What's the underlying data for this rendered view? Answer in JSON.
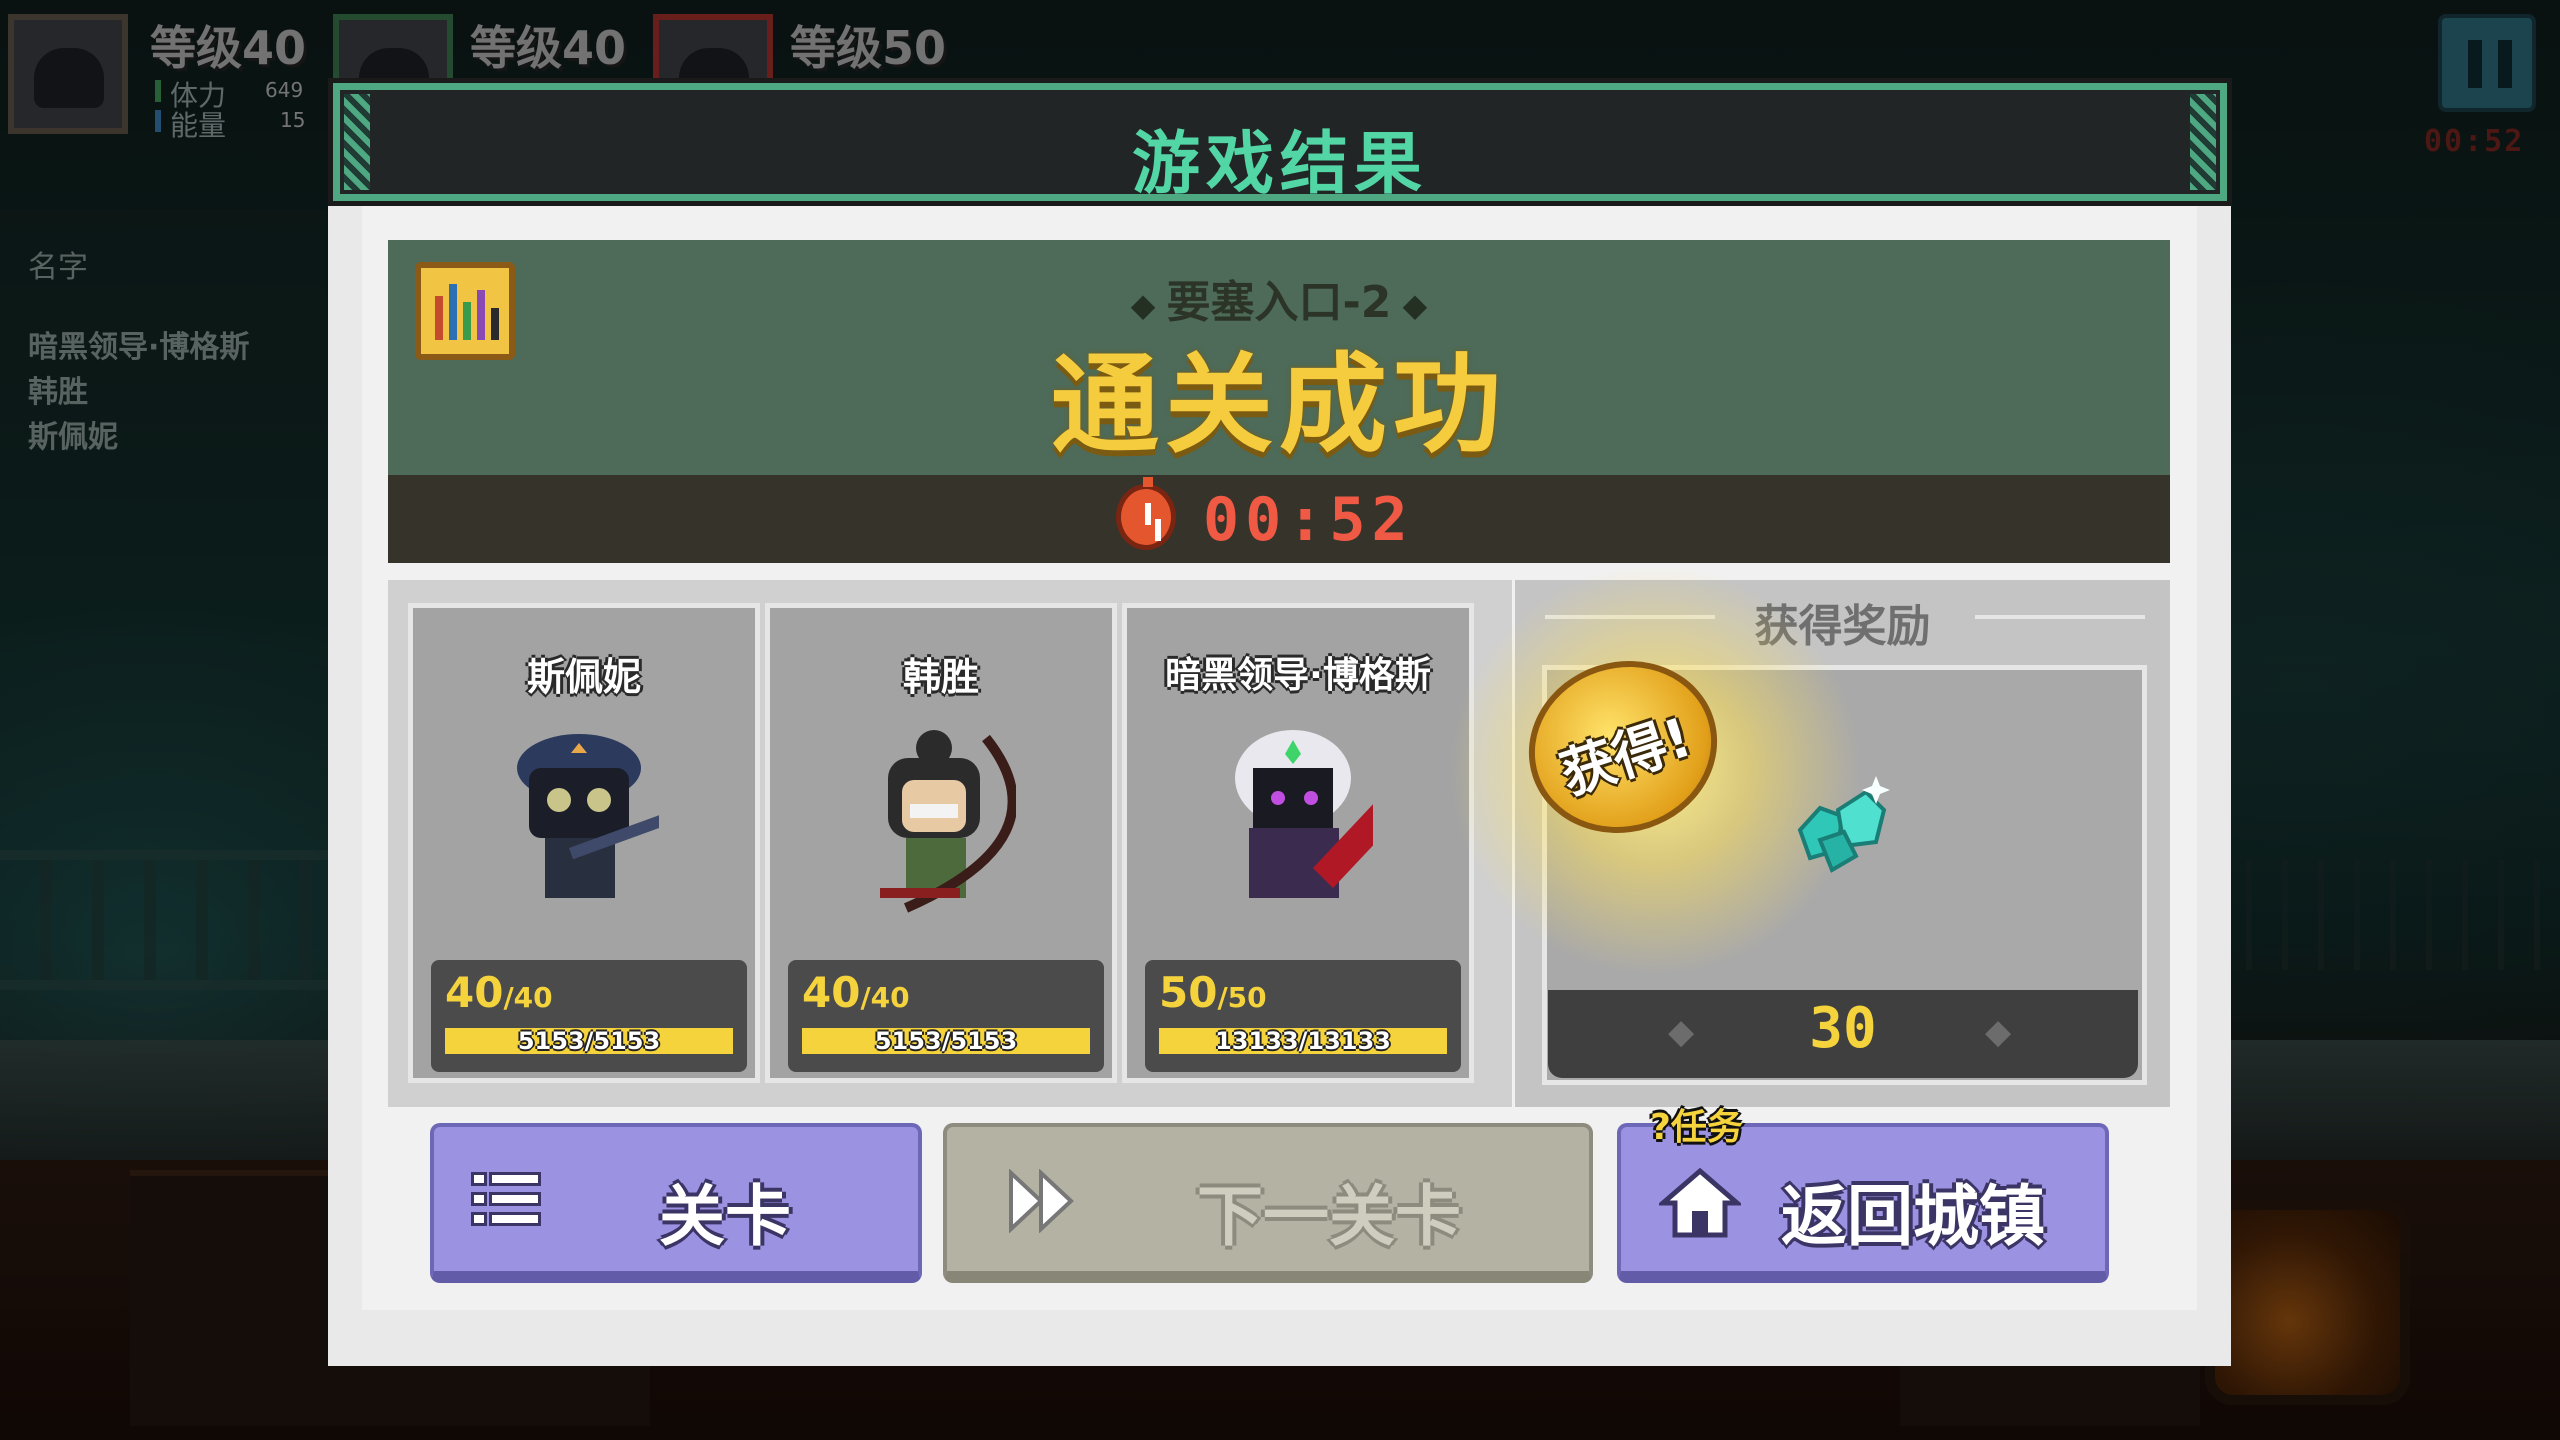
{
  "hud": {
    "party": [
      {
        "level": "等级40",
        "stamina_label": "体力",
        "stamina_value": "649",
        "energy_label": "能量",
        "energy_value": "15"
      },
      {
        "level": "等级40"
      },
      {
        "level": "等级50"
      }
    ],
    "side_list": {
      "header": "名字",
      "names": [
        "暗黑领导·博格斯",
        "韩胜",
        "斯佩妮"
      ]
    },
    "timer": "00:52"
  },
  "dialog": {
    "title": "游戏结果",
    "stage_name": "要塞入口-2",
    "result_text": "通关成功",
    "clear_time": "00:52"
  },
  "heroes": [
    {
      "name": "斯佩妮",
      "level": "40",
      "level_max": "/40",
      "hp": "5153/5153",
      "level_fill": 1.0,
      "hp_fill": 1.0
    },
    {
      "name": "韩胜",
      "level": "40",
      "level_max": "/40",
      "hp": "5153/5153",
      "level_fill": 1.0,
      "hp_fill": 1.0
    },
    {
      "name": "暗黑领导·博格斯",
      "level": "50",
      "level_max": "/50",
      "hp": "13133/13133",
      "level_fill": 1.0,
      "hp_fill": 1.0
    }
  ],
  "reward": {
    "title": "获得奖励",
    "badge": "获得!",
    "count": "30",
    "item_icon": "cyan-gem-icon"
  },
  "buttons": {
    "stage": "关卡",
    "next": "下一关卡",
    "town": "返回城镇",
    "quest_tag": "任务"
  },
  "colors": {
    "title_green": "#53d6a5",
    "gold": "#f4cc3d",
    "timer_red": "#f05a45",
    "button_purple": "#9c92e2",
    "button_disabled": "#b4b2a3"
  }
}
